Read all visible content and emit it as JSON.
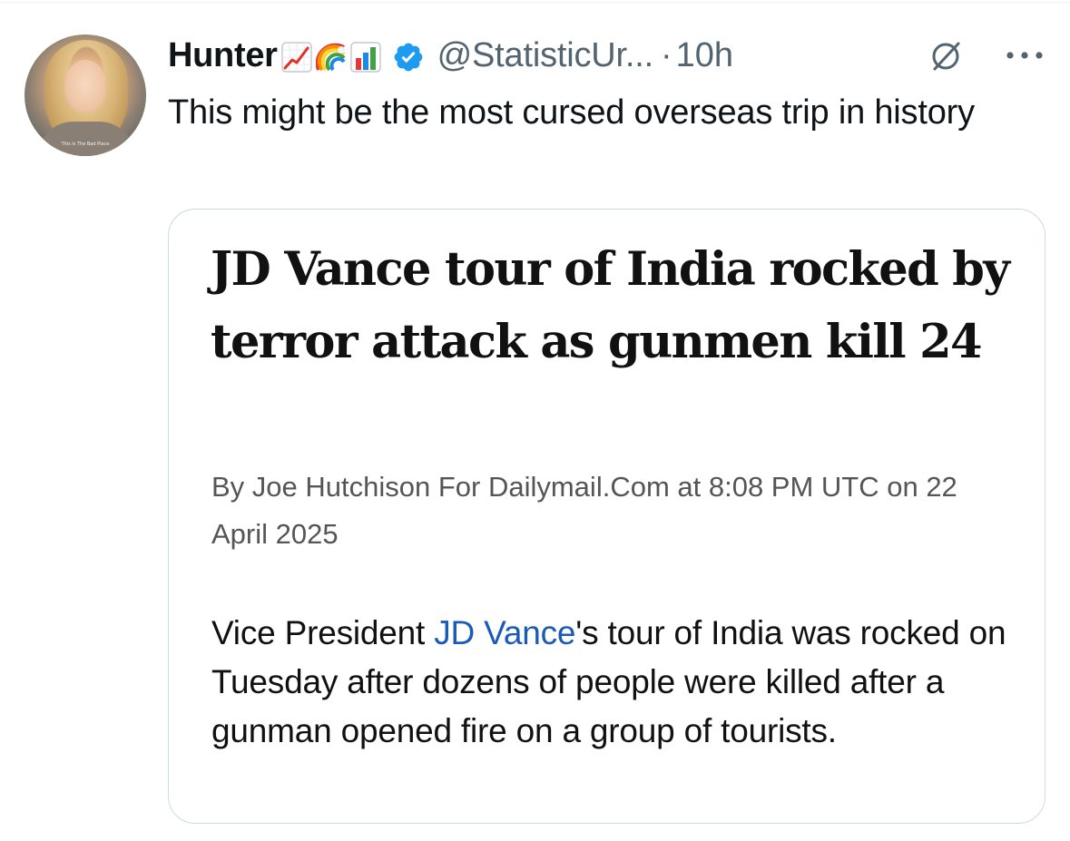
{
  "tweet": {
    "author": {
      "display_name": "Hunter",
      "name_emojis": [
        "chart-increasing-emoji",
        "rainbow-emoji",
        "bar-chart-emoji"
      ],
      "handle": "@StatisticUr...",
      "verified": true,
      "avatar_caption": "This is The Bad Place"
    },
    "separator": "·",
    "timestamp": "10h",
    "text": "This might be the most cursed overseas trip in history",
    "actions": {
      "grok_icon": "grok-icon",
      "more_icon": "more-options-icon"
    }
  },
  "article_card": {
    "title": "JD Vance tour of India rocked by terror attack as gunmen kill 24",
    "byline": "By Joe Hutchison For Dailymail.Com at 8:08 PM UTC on 22 April 2025",
    "body_before_link": "Vice President ",
    "body_link": "JD Vance",
    "body_after_link": "'s tour of India was rocked on Tuesday after dozens of people were killed after a gunman opened fire on a group of tourists."
  },
  "colors": {
    "text_primary": "#0f1419",
    "text_secondary": "#536471",
    "verified_blue": "#1d9bf0",
    "card_border": "#cfd9de",
    "link_blue": "#1a5bb8"
  }
}
